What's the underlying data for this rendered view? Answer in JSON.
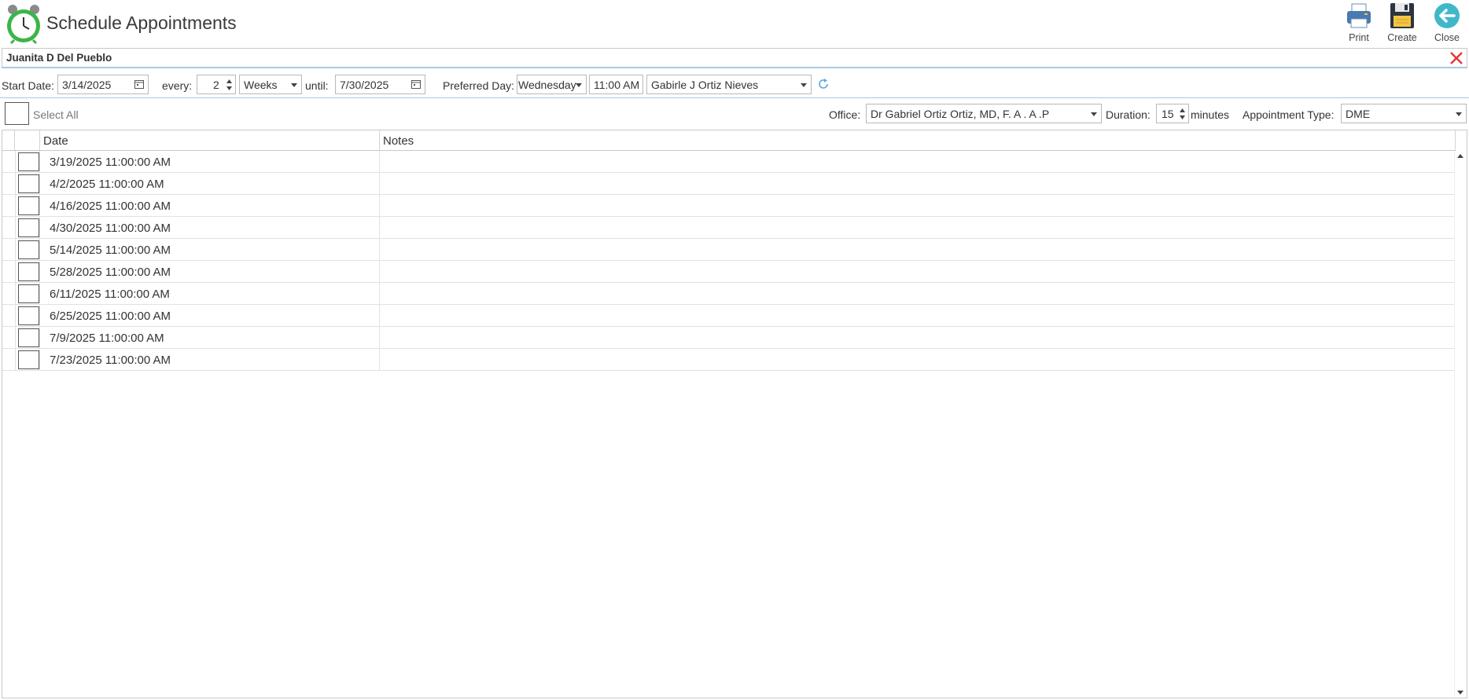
{
  "app": {
    "title": "Schedule Appointments",
    "icon": "alarm-clock-icon"
  },
  "toolbar": {
    "print_label": "Print",
    "create_label": "Create",
    "close_label": "Close"
  },
  "patient": {
    "name": "Juanita D Del Pueblo"
  },
  "schedule": {
    "start_date_label": "Start Date:",
    "start_date": "3/14/2025",
    "every_label": "every:",
    "every_value": "2",
    "unit": "Weeks",
    "until_label": "until:",
    "until_date": "7/30/2025",
    "preferred_day_label": "Preferred Day:",
    "preferred_day": "Wednesday",
    "time": "11:00 AM",
    "provider": "Gabirle J Ortiz Nieves"
  },
  "options": {
    "select_all_label": "Select All",
    "office_label": "Office:",
    "office": "Dr Gabriel Ortiz Ortiz, MD, F. A . A .P",
    "duration_label": "Duration:",
    "duration": "15",
    "duration_unit": "minutes",
    "appointment_type_label": "Appointment Type:",
    "appointment_type": "DME"
  },
  "grid": {
    "columns": [
      "Date",
      "Notes"
    ],
    "rows": [
      {
        "date": "3/19/2025 11:00:00 AM",
        "notes": ""
      },
      {
        "date": "4/2/2025 11:00:00 AM",
        "notes": ""
      },
      {
        "date": "4/16/2025 11:00:00 AM",
        "notes": ""
      },
      {
        "date": "4/30/2025 11:00:00 AM",
        "notes": ""
      },
      {
        "date": "5/14/2025 11:00:00 AM",
        "notes": ""
      },
      {
        "date": "5/28/2025 11:00:00 AM",
        "notes": ""
      },
      {
        "date": "6/11/2025 11:00:00 AM",
        "notes": ""
      },
      {
        "date": "6/25/2025 11:00:00 AM",
        "notes": ""
      },
      {
        "date": "7/9/2025 11:00:00 AM",
        "notes": ""
      },
      {
        "date": "7/23/2025 11:00:00 AM",
        "notes": ""
      }
    ]
  },
  "colors": {
    "accent": "#a9c8e6",
    "close_red": "#e53935",
    "clock_green": "#3cb54a",
    "refresh_blue": "#5aa9e6"
  }
}
